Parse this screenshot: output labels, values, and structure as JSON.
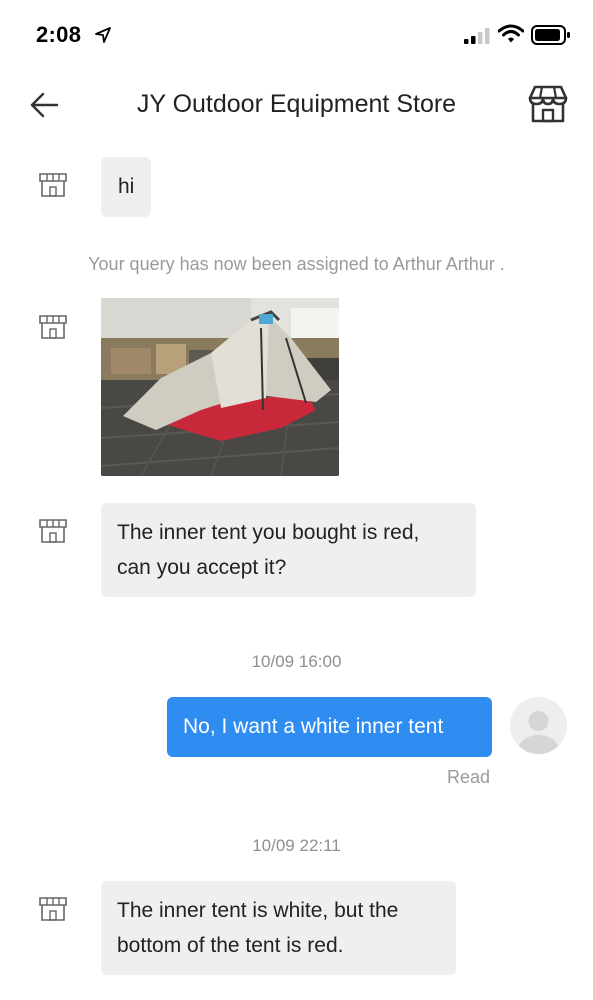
{
  "status_bar": {
    "time": "2:08"
  },
  "header": {
    "title": "JY Outdoor Equipment Store",
    "back_icon": "arrow-left-icon",
    "store_icon": "storefront-icon"
  },
  "colors": {
    "incoming_bubble": "#efefef",
    "outgoing_bubble": "#2f8cf0",
    "muted_text": "#9a9a9a"
  },
  "messages": [
    {
      "from": "store",
      "type": "text",
      "text": "hi"
    },
    {
      "from": "system",
      "type": "note",
      "text": "Your query has now been assigned to Arthur Arthur ."
    },
    {
      "from": "store",
      "type": "image",
      "alt": "tent photo"
    },
    {
      "from": "store",
      "type": "text",
      "lines": [
        "The inner tent you bought is red,",
        "can you accept it?"
      ]
    },
    {
      "type": "timestamp",
      "text": "10/09 16:00"
    },
    {
      "from": "user",
      "type": "text",
      "text": "No, I want a white inner tent",
      "status": "Read"
    },
    {
      "type": "timestamp",
      "text": "10/09 22:11"
    },
    {
      "from": "store",
      "type": "text",
      "lines": [
        "The inner tent is white, but the",
        "bottom of the tent is red."
      ]
    }
  ]
}
